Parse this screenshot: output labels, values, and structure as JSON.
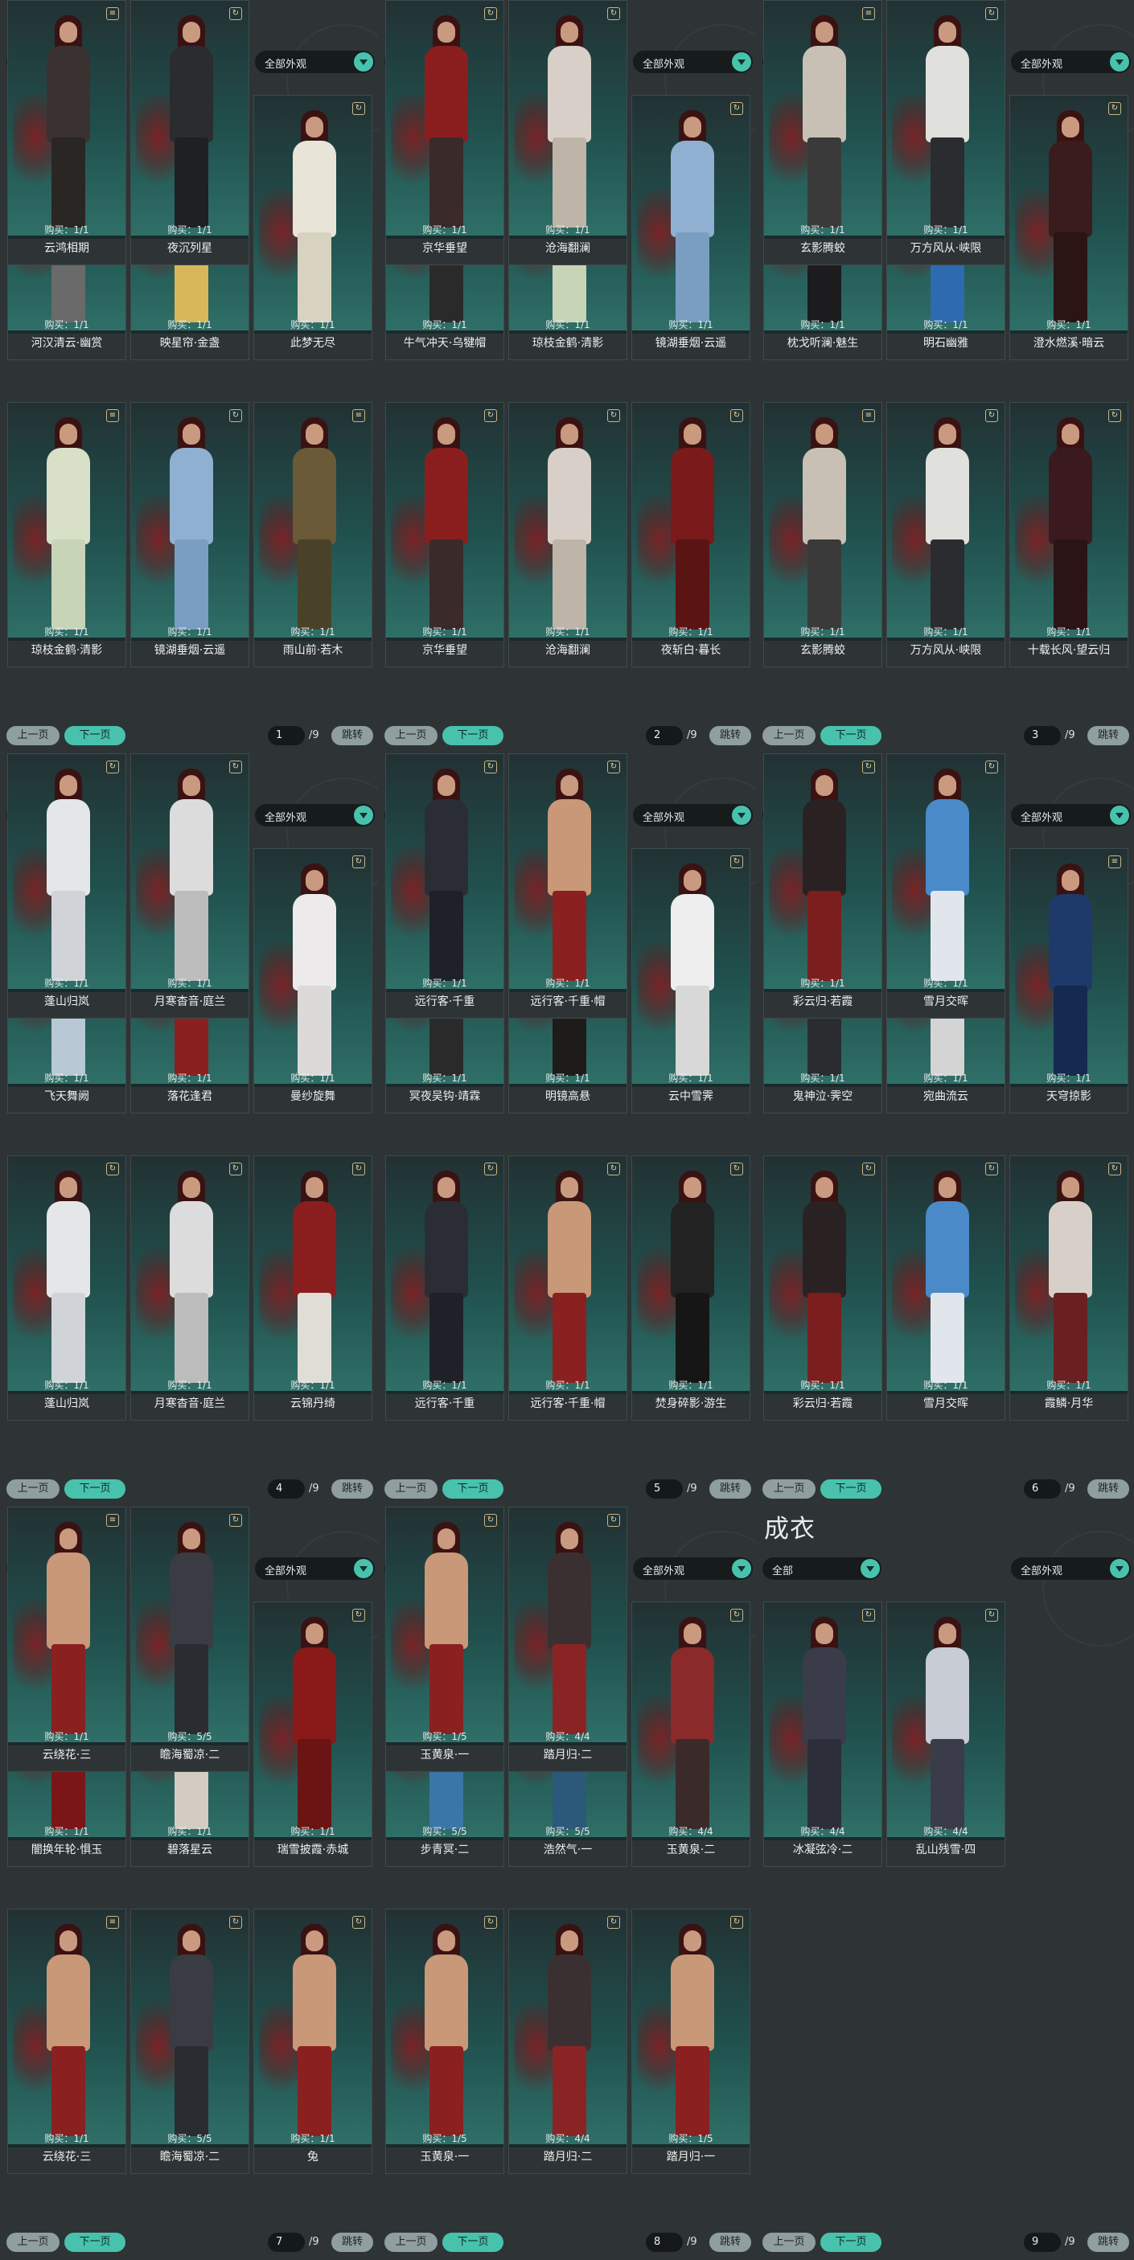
{
  "common": {
    "title": "成衣",
    "filter_all": "全部",
    "filter_appearance": "全部外观",
    "prev": "上一页",
    "next": "下一页",
    "jump": "跳转"
  },
  "panels": [
    {
      "page": "1",
      "total": "/9",
      "items": [
        {
          "name": "河汉清云·幽赏",
          "count": "购买：1/1",
          "icon": "trash",
          "palette": [
            "#d8d8d8",
            "#6a6a6a"
          ]
        },
        {
          "name": "映星帘·金盏",
          "count": "购买：1/1",
          "icon": "trash",
          "palette": [
            "#e6c56a",
            "#d8b65a"
          ]
        },
        {
          "name": "此梦无尽",
          "count": "购买：1/1",
          "icon": "preview",
          "palette": [
            "#e8e4d8",
            "#d8d2c0"
          ]
        },
        {
          "name": "琼枝金鹤·清影",
          "count": "购买：1/1",
          "icon": "trash",
          "palette": [
            "#d8e0c8",
            "#c8d4b8"
          ]
        },
        {
          "name": "镜湖垂烟·云遥",
          "count": "购买：1/1",
          "icon": "preview",
          "palette": [
            "#8fb0d0",
            "#7a9ec2"
          ]
        },
        {
          "name": "雨山前·若木",
          "count": "购买：1/1",
          "icon": "trash",
          "palette": [
            "#6a5a38",
            "#4a4228"
          ]
        },
        {
          "name": "云鸿相期",
          "count": "购买：1/1",
          "icon": "trash",
          "palette": [
            "#3a3230",
            "#2a2624"
          ]
        },
        {
          "name": "夜沉列星",
          "count": "购买：1/1",
          "icon": "preview",
          "palette": [
            "#2a2c30",
            "#1e2024"
          ]
        }
      ]
    },
    {
      "page": "2",
      "total": "/9",
      "items": [
        {
          "name": "牛气冲天·乌犍帽",
          "count": "购买：1/1",
          "icon": "preview",
          "palette": [
            "#c89878",
            "#2a2a2a"
          ]
        },
        {
          "name": "琼枝金鹤·清影",
          "count": "购买：1/1",
          "icon": "trash",
          "palette": [
            "#d8e0c8",
            "#c8d4b8"
          ]
        },
        {
          "name": "镜湖垂烟·云遥",
          "count": "购买：1/1",
          "icon": "preview",
          "palette": [
            "#8fb0d0",
            "#7a9ec2"
          ]
        },
        {
          "name": "京华垂望",
          "count": "购买：1/1",
          "icon": "preview",
          "palette": [
            "#8a1e1e",
            "#3a2a2a"
          ]
        },
        {
          "name": "沧海翻澜",
          "count": "购买：1/1",
          "icon": "preview",
          "palette": [
            "#d8d0c8",
            "#bfb4a8"
          ]
        },
        {
          "name": "夜斩白·暮长",
          "count": "购买：1/1",
          "icon": "preview",
          "palette": [
            "#7a1a1a",
            "#5a1414"
          ]
        },
        {
          "name": "京华垂望",
          "count": "购买：1/1",
          "icon": "preview",
          "palette": [
            "#8a1e1e",
            "#3a2a2a"
          ]
        },
        {
          "name": "沧海翻澜",
          "count": "购买：1/1",
          "icon": "preview",
          "palette": [
            "#d8d0c8",
            "#bfb4a8"
          ]
        }
      ]
    },
    {
      "page": "3",
      "total": "/9",
      "items": [
        {
          "name": "枕戈听澜·魅生",
          "count": "购买：1/1",
          "icon": "trash",
          "palette": [
            "#2a2a2c",
            "#1c1c1e"
          ]
        },
        {
          "name": "明石幽雅",
          "count": "购买：1/1",
          "icon": "preview",
          "palette": [
            "#3a3a44",
            "#2e6ab0"
          ]
        },
        {
          "name": "澄水燃溪·暗云",
          "count": "购买：1/1",
          "icon": "preview",
          "palette": [
            "#3a1c1c",
            "#2a1414"
          ]
        },
        {
          "name": "玄影腾蛟",
          "count": "购买：1/1",
          "icon": "trash",
          "palette": [
            "#c8c0b4",
            "#3a3a3a"
          ]
        },
        {
          "name": "万方风从·峡限",
          "count": "购买：1/1",
          "icon": "preview",
          "palette": [
            "#e0e0dc",
            "#2a2c30"
          ]
        },
        {
          "name": "十载长风·望云归",
          "count": "购买：1/1",
          "icon": "preview",
          "palette": [
            "#3a1a1e",
            "#2a1416"
          ]
        },
        {
          "name": "玄影腾蛟",
          "count": "购买：1/1",
          "icon": "trash",
          "palette": [
            "#c8c0b4",
            "#3a3a3a"
          ]
        },
        {
          "name": "万方风从·峡限",
          "count": "购买：1/1",
          "icon": "preview",
          "palette": [
            "#e0e0dc",
            "#2a2c30"
          ]
        }
      ]
    },
    {
      "page": "4",
      "total": "/9",
      "items": [
        {
          "name": "飞天舞阙",
          "count": "购买：1/1",
          "icon": "preview",
          "palette": [
            "#d8dce0",
            "#b8c8d4"
          ]
        },
        {
          "name": "落花逢君",
          "count": "购买：1/1",
          "icon": "preview",
          "palette": [
            "#c89878",
            "#8a2020"
          ]
        },
        {
          "name": "曼纱旋舞",
          "count": "购买：1/1",
          "icon": "preview",
          "palette": [
            "#eceaea",
            "#dcdad8"
          ]
        },
        {
          "name": "蓬山归岚",
          "count": "购买：1/1",
          "icon": "preview",
          "palette": [
            "#e4e6e8",
            "#d0d4d8"
          ]
        },
        {
          "name": "月寒杳音·庭兰",
          "count": "购买：1/1",
          "icon": "preview",
          "palette": [
            "#dcdcdc",
            "#bcbcbc"
          ]
        },
        {
          "name": "云锦丹绮",
          "count": "购买：1/1",
          "icon": "preview",
          "palette": [
            "#8a1e1e",
            "#e0dcd6"
          ]
        },
        {
          "name": "蓬山归岚",
          "count": "购买：1/1",
          "icon": "preview",
          "palette": [
            "#e4e6e8",
            "#d0d4d8"
          ]
        },
        {
          "name": "月寒杳音·庭兰",
          "count": "购买：1/1",
          "icon": "preview",
          "palette": [
            "#dcdcdc",
            "#bcbcbc"
          ]
        }
      ]
    },
    {
      "page": "5",
      "total": "/9",
      "items": [
        {
          "name": "冥夜吴钩·靖霖",
          "count": "购买：1/1",
          "icon": "preview",
          "palette": [
            "#e0ddd6",
            "#2a2a2a"
          ]
        },
        {
          "name": "明镜高悬",
          "count": "购买：1/1",
          "icon": "trash",
          "palette": [
            "#2a2624",
            "#1e1c1a"
          ]
        },
        {
          "name": "云中雪霁",
          "count": "购买：1/1",
          "icon": "preview",
          "palette": [
            "#eeeeee",
            "#d8d8d8"
          ]
        },
        {
          "name": "远行客·千重",
          "count": "购买：1/1",
          "icon": "preview",
          "palette": [
            "#2a2e34",
            "#1e2228"
          ]
        },
        {
          "name": "远行客·千重·帽",
          "count": "购买：1/1",
          "icon": "preview",
          "palette": [
            "#c89878",
            "#8a2020"
          ]
        },
        {
          "name": "焚身碎影·游生",
          "count": "购买：1/1",
          "icon": "preview",
          "palette": [
            "#222222",
            "#161616"
          ]
        },
        {
          "name": "远行客·千重",
          "count": "购买：1/1",
          "icon": "preview",
          "palette": [
            "#2a2e34",
            "#1e2228"
          ]
        },
        {
          "name": "远行客·千重·帽",
          "count": "购买：1/1",
          "icon": "preview",
          "palette": [
            "#c89878",
            "#8a2020"
          ]
        }
      ]
    },
    {
      "page": "6",
      "total": "/9",
      "items": [
        {
          "name": "鬼神泣·霁空",
          "count": "购买：1/1",
          "icon": "preview",
          "palette": [
            "#3a3c40",
            "#2a2c30"
          ]
        },
        {
          "name": "宛曲流云",
          "count": "购买：1/1",
          "icon": "preview",
          "palette": [
            "#e8e8e8",
            "#d4d4d4"
          ]
        },
        {
          "name": "天穹掠影",
          "count": "购买：1/1",
          "icon": "trash",
          "palette": [
            "#1e3a6a",
            "#142a50"
          ]
        },
        {
          "name": "彩云归·若霞",
          "count": "购买：1/1",
          "icon": "preview",
          "palette": [
            "#2a2222",
            "#7a1e1e"
          ]
        },
        {
          "name": "雪月交晖",
          "count": "购买：1/1",
          "icon": "preview",
          "palette": [
            "#4a8ac8",
            "#e0e6ec"
          ]
        },
        {
          "name": "霞鳞·月华",
          "count": "购买：1/1",
          "icon": "preview",
          "palette": [
            "#d8d0c8",
            "#6a2020"
          ]
        },
        {
          "name": "彩云归·若霞",
          "count": "购买：1/1",
          "icon": "preview",
          "palette": [
            "#2a2222",
            "#7a1e1e"
          ]
        },
        {
          "name": "雪月交晖",
          "count": "购买：1/1",
          "icon": "preview",
          "palette": [
            "#4a8ac8",
            "#e0e6ec"
          ]
        }
      ]
    },
    {
      "page": "7",
      "total": "/9",
      "items": [
        {
          "name": "闇换年轮·惧玉",
          "count": "购买：1/1",
          "icon": "trash",
          "palette": [
            "#9a1e22",
            "#7a1618"
          ]
        },
        {
          "name": "碧落星云",
          "count": "购买：1/1",
          "icon": "preview",
          "palette": [
            "#e6e2da",
            "#d2ccc2"
          ]
        },
        {
          "name": "瑞雪披霞·赤城",
          "count": "购买：1/1",
          "icon": "preview",
          "palette": [
            "#8a1a1a",
            "#6a1414"
          ]
        },
        {
          "name": "云绕花·三",
          "count": "购买：1/1",
          "icon": "trash",
          "palette": [
            "#c89878",
            "#8a2020"
          ]
        },
        {
          "name": "瞻海蜀凉·二",
          "count": "购买：5/5",
          "icon": "preview",
          "palette": [
            "#3a3c44",
            "#2a2c32"
          ]
        },
        {
          "name": "兔",
          "count": "购买：1/1",
          "icon": "preview",
          "palette": [
            "#c89878",
            "#8a2020"
          ]
        },
        {
          "name": "云绕花·三",
          "count": "购买：1/1",
          "icon": "trash",
          "palette": [
            "#c89878",
            "#8a2020"
          ]
        },
        {
          "name": "瞻海蜀凉·二",
          "count": "购买：5/5",
          "icon": "preview",
          "palette": [
            "#3a3c44",
            "#2a2c32"
          ]
        }
      ]
    },
    {
      "page": "8",
      "total": "/9",
      "items": [
        {
          "name": "步青冥·二",
          "count": "购买：5/5",
          "icon": "preview",
          "palette": [
            "#4a8ac0",
            "#3a76a8"
          ]
        },
        {
          "name": "浩然气·一",
          "count": "购买：5/5",
          "icon": "preview",
          "palette": [
            "#3a6a90",
            "#2c587a"
          ]
        },
        {
          "name": "玉黄泉·二",
          "count": "购买：4/4",
          "icon": "preview",
          "palette": [
            "#8a2a2a",
            "#3a2a2a"
          ]
        },
        {
          "name": "玉黄泉·一",
          "count": "购买：1/5",
          "icon": "preview",
          "palette": [
            "#c89878",
            "#8a2020"
          ]
        },
        {
          "name": "踏月归·二",
          "count": "购买：4/4",
          "icon": "preview",
          "palette": [
            "#3a3032",
            "#8a2424"
          ]
        },
        {
          "name": "踏月归·一",
          "count": "购买：1/5",
          "icon": "preview",
          "palette": [
            "#c89878",
            "#8a2020"
          ]
        },
        {
          "name": "玉黄泉·一",
          "count": "购买：1/5",
          "icon": "preview",
          "palette": [
            "#c89878",
            "#8a2020"
          ]
        },
        {
          "name": "踏月归·二",
          "count": "购买：4/4",
          "icon": "preview",
          "palette": [
            "#3a3032",
            "#8a2424"
          ]
        }
      ]
    },
    {
      "page": "9",
      "total": "/9",
      "items": [
        {
          "name": "冰凝弦冷·二",
          "count": "购买：4/4",
          "icon": "preview",
          "palette": [
            "#3a3c4a",
            "#2c2e3a"
          ]
        },
        {
          "name": "乱山残雪·四",
          "count": "购买：4/4",
          "icon": "preview",
          "palette": [
            "#c8ccd4",
            "#3a3c4a"
          ]
        }
      ]
    }
  ]
}
